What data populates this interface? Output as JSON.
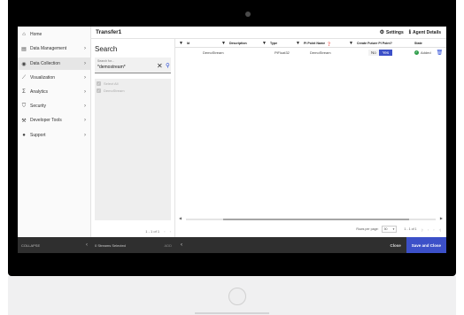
{
  "sidebar": {
    "items": [
      {
        "label": "Home",
        "icon": "home-icon",
        "glyph": "⌂",
        "chevron": ""
      },
      {
        "label": "Data Management",
        "icon": "database-icon",
        "glyph": "▤",
        "chevron": "›"
      },
      {
        "label": "Data Collection",
        "icon": "data-collection-icon",
        "glyph": "◉",
        "chevron": "›"
      },
      {
        "label": "Visualization",
        "icon": "chart-line-icon",
        "glyph": "⟋",
        "chevron": "›"
      },
      {
        "label": "Analytics",
        "icon": "sigma-icon",
        "glyph": "Σ",
        "chevron": "›"
      },
      {
        "label": "Security",
        "icon": "shield-icon",
        "glyph": "⛉",
        "chevron": "›"
      },
      {
        "label": "Developer Tools",
        "icon": "wrench-icon",
        "glyph": "⚒",
        "chevron": "›"
      },
      {
        "label": "Support",
        "icon": "help-icon",
        "glyph": "●",
        "chevron": "›"
      }
    ],
    "collapse_label": "COLLAPSE",
    "collapse_arrow": "‹"
  },
  "header": {
    "title": "Transfer1",
    "settings_label": "Settings",
    "agent_details_label": "Agent Details"
  },
  "search": {
    "title": "Search",
    "field_label": "Search for...",
    "value": "*demostream*",
    "clear_glyph": "✕",
    "search_glyph": "⚲",
    "select_all_label": "Select All",
    "items": [
      "DemoStream"
    ],
    "pager_text": "1 - 1 of 1",
    "pager_prev": "‹",
    "pager_next": "›"
  },
  "table": {
    "columns": [
      "Id",
      "Description",
      "Type",
      "PI Point Name",
      "Create Future PI Point?",
      "State"
    ],
    "rows": [
      {
        "id": "DemoStream",
        "description": "",
        "type": "PiFloat32",
        "pi_point_name": "DemoStream",
        "no_label": "No",
        "yes_label": "Yes",
        "state": "Added"
      }
    ],
    "rows_per_page_label": "Rows per page:",
    "rows_per_page": "50",
    "pagination_text": "1 - 1 of 1"
  },
  "footer": {
    "streams_selected": "0 Streams Selected",
    "add_label": "ADD",
    "back_arrow": "‹",
    "close_label": "Close",
    "save_close_label": "Save and Close"
  },
  "colors": {
    "accent": "#3c50c8",
    "success": "#2e9d4a",
    "footer_bg": "#2f2f2f"
  }
}
